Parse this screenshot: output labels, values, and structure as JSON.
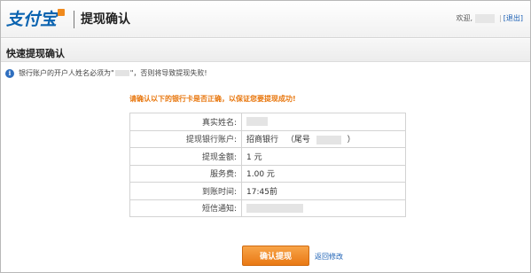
{
  "header": {
    "logo_text": "支付宝",
    "page_title": "提现确认",
    "welcome_label": "欢迎,",
    "logout_label": "[退出]",
    "separator": "|"
  },
  "section": {
    "title": "快速提现确认"
  },
  "notice": {
    "icon": "i",
    "text_before": "银行账户的开户人姓名必须为\"",
    "text_after": "\"，否则将导致提现失败!"
  },
  "confirm_message": "请确认以下的银行卡是否正确，以保证您要提现成功!",
  "details": {
    "rows": [
      {
        "label": "真实姓名:",
        "value": ""
      },
      {
        "label": "提现银行账户:",
        "bank": "招商银行",
        "tail_open": "（尾号",
        "tail_close": "）"
      },
      {
        "label": "提现金额:",
        "value": "1 元"
      },
      {
        "label": "服务费:",
        "value": "1.00 元"
      },
      {
        "label": "到账时间:",
        "value": "17:45前"
      },
      {
        "label": "短信通知:",
        "value": ""
      }
    ]
  },
  "actions": {
    "confirm_label": "确认提现",
    "back_label": "返回修改"
  },
  "colors": {
    "brand_blue": "#0a63b0",
    "accent_orange": "#e8770e",
    "link_blue": "#1a5fb4"
  }
}
